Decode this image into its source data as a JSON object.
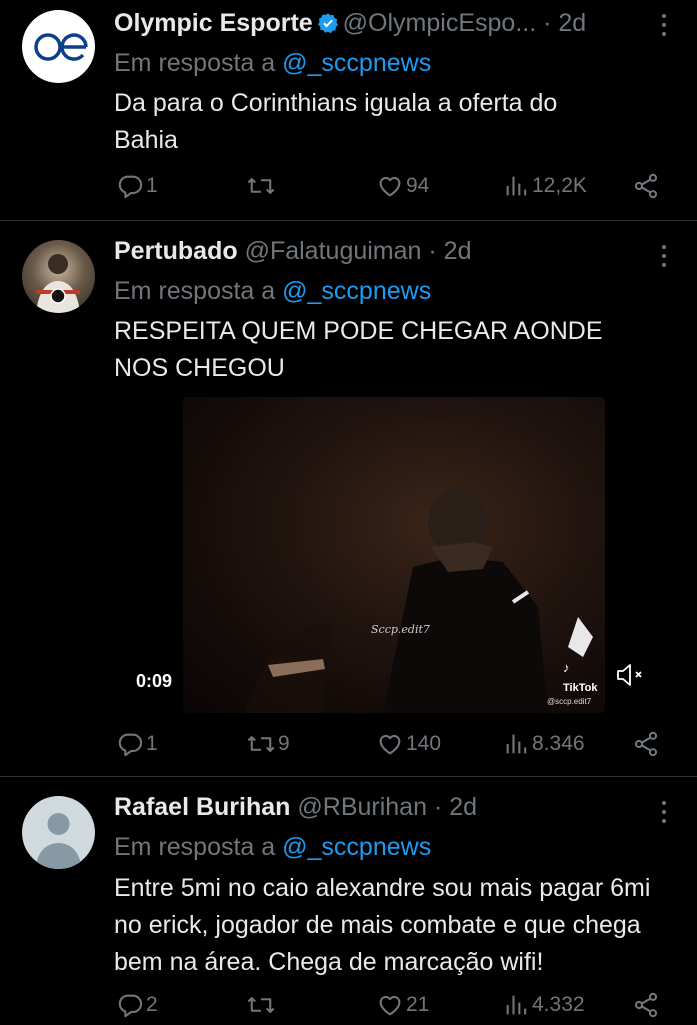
{
  "tweets": [
    {
      "name": "Olympic Esporte",
      "verified": true,
      "handle": "@OlympicEspo...",
      "time": "· 2d",
      "reply_prefix": "Em resposta a",
      "reply_to": "@_sccpnews",
      "text": "Da para o Corinthians iguala a oferta do Bahia",
      "avatar_text": "oe",
      "replies": "1",
      "retweets": "",
      "likes": "94",
      "views": "12,2K"
    },
    {
      "name": "Pertubado",
      "verified": false,
      "handle": "@Falatuguiman",
      "time": "· 2d",
      "reply_prefix": "Em resposta a",
      "reply_to": "@_sccpnews",
      "text": "RESPEITA QUEM PODE CHEGAR AONDE NOS CHEGOU",
      "video": {
        "duration": "0:09",
        "watermark": "Sccp.edit7",
        "tiktok_label": "TikTok",
        "tiktok_handle": "@sccp.edit7"
      },
      "replies": "1",
      "retweets": "9",
      "likes": "140",
      "views": "8.346"
    },
    {
      "name": "Rafael Burihan",
      "verified": false,
      "handle": "@RBurihan",
      "time": "· 2d",
      "reply_prefix": "Em resposta a",
      "reply_to": "@_sccpnews",
      "text": "Entre 5mi no caio alexandre sou mais pagar 6mi no erick, jogador de mais combate e que chega bem na área. Chega de marcação wifi!",
      "replies": "2",
      "retweets": "",
      "likes": "21",
      "views": "4.332"
    }
  ],
  "colors": {
    "background": "#000000",
    "text": "#e7e9ea",
    "muted": "#71767b",
    "link": "#1d9bf0",
    "divider": "#2f3336"
  }
}
